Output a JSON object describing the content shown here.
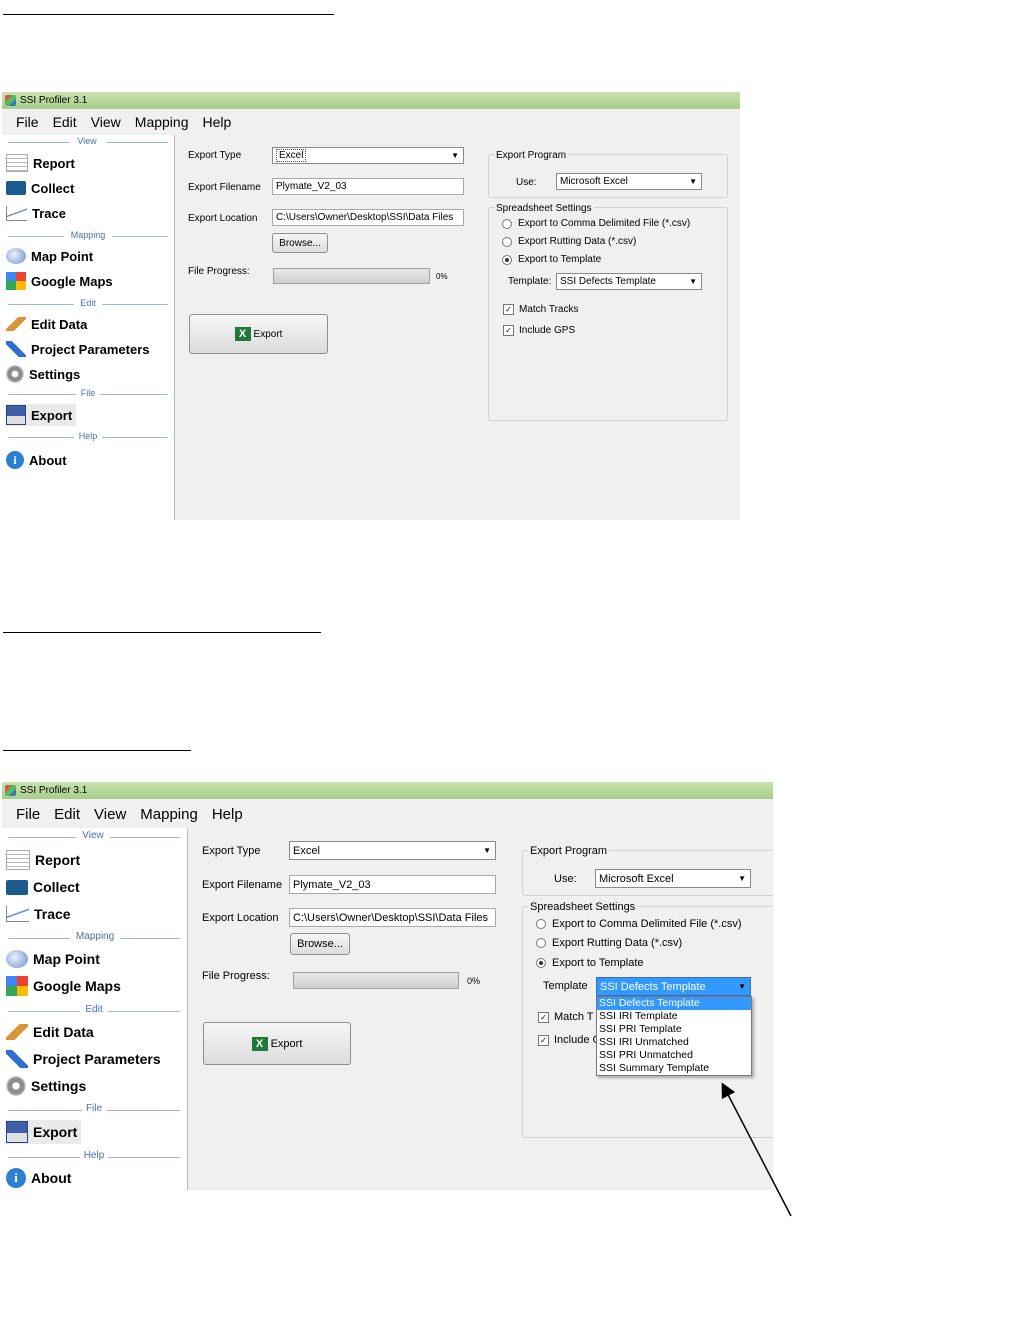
{
  "windows": [
    {
      "title": "SSI Profiler 3.1",
      "menu": [
        "File",
        "Edit",
        "View",
        "Mapping",
        "Help"
      ],
      "sidebar": {
        "groups": {
          "view": "View",
          "mapping": "Mapping",
          "edit": "Edit",
          "file": "File",
          "help": "Help"
        },
        "items": [
          "Report",
          "Collect",
          "Trace",
          "Map Point",
          "Google Maps",
          "Edit Data",
          "Project Parameters",
          "Settings",
          "Export",
          "About"
        ]
      },
      "form": {
        "export_type_label": "Export Type",
        "export_type_value": "Excel",
        "export_filename_label": "Export Filename",
        "export_filename_value": "Plymate_V2_03",
        "export_location_label": "Export Location",
        "export_location_value": "C:\\Users\\Owner\\Desktop\\SSI\\Data Files",
        "browse": "Browse...",
        "file_progress_label": "File Progress:",
        "progress_text": "0%",
        "export_button": "Export"
      },
      "export_program": {
        "title": "Export Program",
        "use_label": "Use:",
        "use_value": "Microsoft Excel"
      },
      "spreadsheet": {
        "title": "Spreadsheet Settings",
        "radio_csv": "Export to Comma Delimited File (*.csv)",
        "radio_rutting": "Export Rutting Data (*.csv)",
        "radio_template": "Export to Template",
        "template_label": "Template:",
        "template_value": "SSI Defects Template",
        "match_tracks": "Match Tracks",
        "include_gps": "Include GPS"
      }
    },
    {
      "title": "SSI Profiler 3.1",
      "menu": [
        "File",
        "Edit",
        "View",
        "Mapping",
        "Help"
      ],
      "sidebar": {
        "groups": {
          "view": "View",
          "mapping": "Mapping",
          "edit": "Edit",
          "file": "File",
          "help": "Help"
        },
        "items": [
          "Report",
          "Collect",
          "Trace",
          "Map Point",
          "Google Maps",
          "Edit Data",
          "Project Parameters",
          "Settings",
          "Export",
          "About"
        ]
      },
      "form": {
        "export_type_label": "Export Type",
        "export_type_value": "Excel",
        "export_filename_label": "Export Filename",
        "export_filename_value": "Plymate_V2_03",
        "export_location_label": "Export Location",
        "export_location_value": "C:\\Users\\Owner\\Desktop\\SSI\\Data Files",
        "browse": "Browse...",
        "file_progress_label": "File Progress:",
        "progress_text": "0%",
        "export_button": "Export"
      },
      "export_program": {
        "title": "Export Program",
        "use_label": "Use:",
        "use_value": "Microsoft Excel"
      },
      "spreadsheet": {
        "title": "Spreadsheet Settings",
        "radio_csv": "Export to Comma Delimited File (*.csv)",
        "radio_rutting": "Export Rutting Data (*.csv)",
        "radio_template": "Export to Template",
        "template_label": "Template",
        "template_value": "SSI Defects Template",
        "match_tracks_partial": "Match T",
        "include_gps_partial": "Include G",
        "template_options": [
          "SSI Defects Template",
          "SSI IRI Template",
          "SSI PRI Template",
          "SSI IRI Unmatched",
          "SSI PRI Unmatched",
          "SSI Summary Template"
        ]
      }
    }
  ],
  "icons": [
    "report-icon",
    "collect-icon",
    "trace-icon",
    "map-point-icon",
    "google-maps-icon",
    "edit-data-icon",
    "project-parameters-icon",
    "settings-icon",
    "export-icon",
    "about-icon"
  ]
}
